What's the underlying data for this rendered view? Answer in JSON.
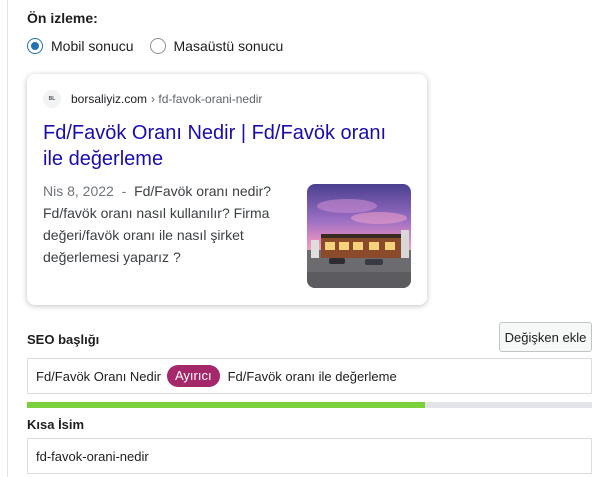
{
  "preview": {
    "label": "Ön izleme:",
    "mode_options": [
      {
        "label": "Mobil sonucu",
        "checked": true
      },
      {
        "label": "Masaüstü sonucu",
        "checked": false
      }
    ]
  },
  "serp": {
    "favicon_text": "BL",
    "domain": "borsaliyiz.com",
    "path": "› fd-favok-orani-nedir",
    "title": "Fd/Favök Oranı Nedir | Fd/Favök oranı ile değerleme",
    "date": "Nis 8, 2022",
    "date_separator": "-",
    "description": "Fd/Favök oranı nedir? Fd/favök oranı nasıl kullanılır? Firma değeri/favök oranı ile nasıl şirket değerlemesi yaparız ?"
  },
  "seo_title": {
    "label": "SEO başlığı",
    "insert_variable_button": "Değişken ekle",
    "part_before": "Fd/Favök Oranı Nedir",
    "separator_pill": "Ayırıcı",
    "part_after": "Fd/Favök oranı ile değerleme",
    "progress_fraction": 0.705,
    "progress_color": "#7ad03a"
  },
  "slug": {
    "label": "Kısa İsim",
    "value": "fd-favok-orani-nedir"
  },
  "colors": {
    "link": "#1a0dab",
    "radio_accent": "#2271b1",
    "pill": "#a4286a"
  }
}
